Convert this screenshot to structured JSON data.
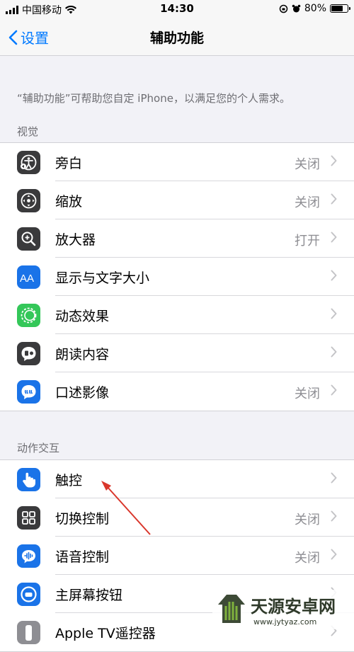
{
  "status_bar": {
    "carrier": "中国移动",
    "time": "14:30",
    "battery": "80%",
    "battery_level": 0.8
  },
  "nav": {
    "back_label": "设置",
    "title": "辅助功能"
  },
  "intro_text": "“辅助功能”可帮助您自定 iPhone，以满足您的个人需求。",
  "sections": [
    {
      "header": "视觉",
      "items": [
        {
          "label": "旁白",
          "value": "关闭",
          "icon": "voiceover-icon",
          "color": "#3a3a3c"
        },
        {
          "label": "缩放",
          "value": "关闭",
          "icon": "zoom-icon",
          "color": "#3a3a3c"
        },
        {
          "label": "放大器",
          "value": "打开",
          "icon": "magnifier-icon",
          "color": "#3a3a3c"
        },
        {
          "label": "显示与文字大小",
          "value": "",
          "icon": "text-size-icon",
          "color": "#1a73e8"
        },
        {
          "label": "动态效果",
          "value": "",
          "icon": "motion-icon",
          "color": "#34c759"
        },
        {
          "label": "朗读内容",
          "value": "",
          "icon": "spoken-content-icon",
          "color": "#3a3a3c"
        },
        {
          "label": "口述影像",
          "value": "关闭",
          "icon": "audio-description-icon",
          "color": "#1a73e8"
        }
      ]
    },
    {
      "header": "动作交互",
      "items": [
        {
          "label": "触控",
          "value": "",
          "icon": "touch-icon",
          "color": "#1a73e8"
        },
        {
          "label": "切换控制",
          "value": "关闭",
          "icon": "switch-control-icon",
          "color": "#3a3a3c"
        },
        {
          "label": "语音控制",
          "value": "关闭",
          "icon": "voice-control-icon",
          "color": "#1a73e8"
        },
        {
          "label": "主屏幕按钮",
          "value": "",
          "icon": "home-button-icon",
          "color": "#1a73e8"
        },
        {
          "label": "Apple TV遥控器",
          "value": "",
          "icon": "apple-tv-remote-icon",
          "color": "#8e8e93"
        }
      ]
    }
  ],
  "watermark": {
    "text": "天源安卓网",
    "url": "www.jytyaz.com"
  }
}
